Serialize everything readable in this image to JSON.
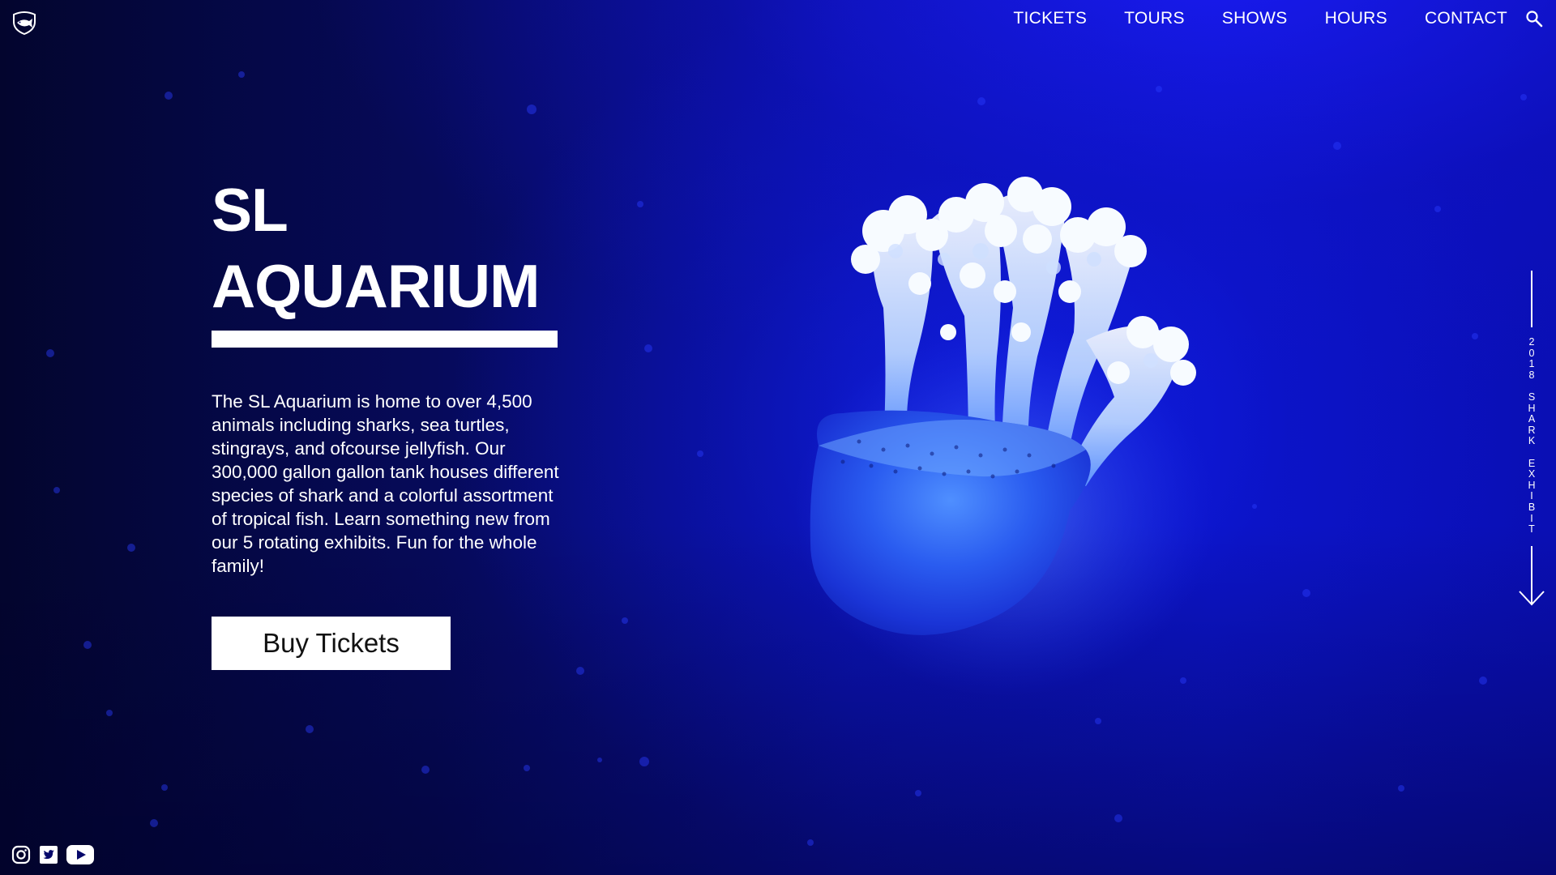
{
  "header": {
    "logo_icon": "fish-shield-logo-icon",
    "nav": [
      "TICKETS",
      "TOURS",
      "SHOWS",
      "HOURS",
      "CONTACT"
    ],
    "search_icon": "search-icon"
  },
  "hero": {
    "title_line1": "SL",
    "title_line2": "AQUARIUM",
    "description": "The SL Aquarium is home to over 4,500 animals including sharks, sea turtles, stingrays, and ofcourse jellyfish. Our 300,000 gallon gallon tank houses different species of shark and a colorful assortment of tropical fish.  Learn something new from our 5 rotating exhibits. Fun for the whole family!",
    "cta_label": "Buy Tickets"
  },
  "exhibit_indicator": {
    "text": "2018 SHARK EXHIBIT",
    "arrow_icon": "arrow-down-icon"
  },
  "social": [
    "instagram-icon",
    "twitter-icon",
    "youtube-icon"
  ],
  "colors": {
    "background": "#06086a",
    "accent_blue": "#0b12c4",
    "text": "#ffffff",
    "button_bg": "#ffffff",
    "button_text": "#111111"
  }
}
